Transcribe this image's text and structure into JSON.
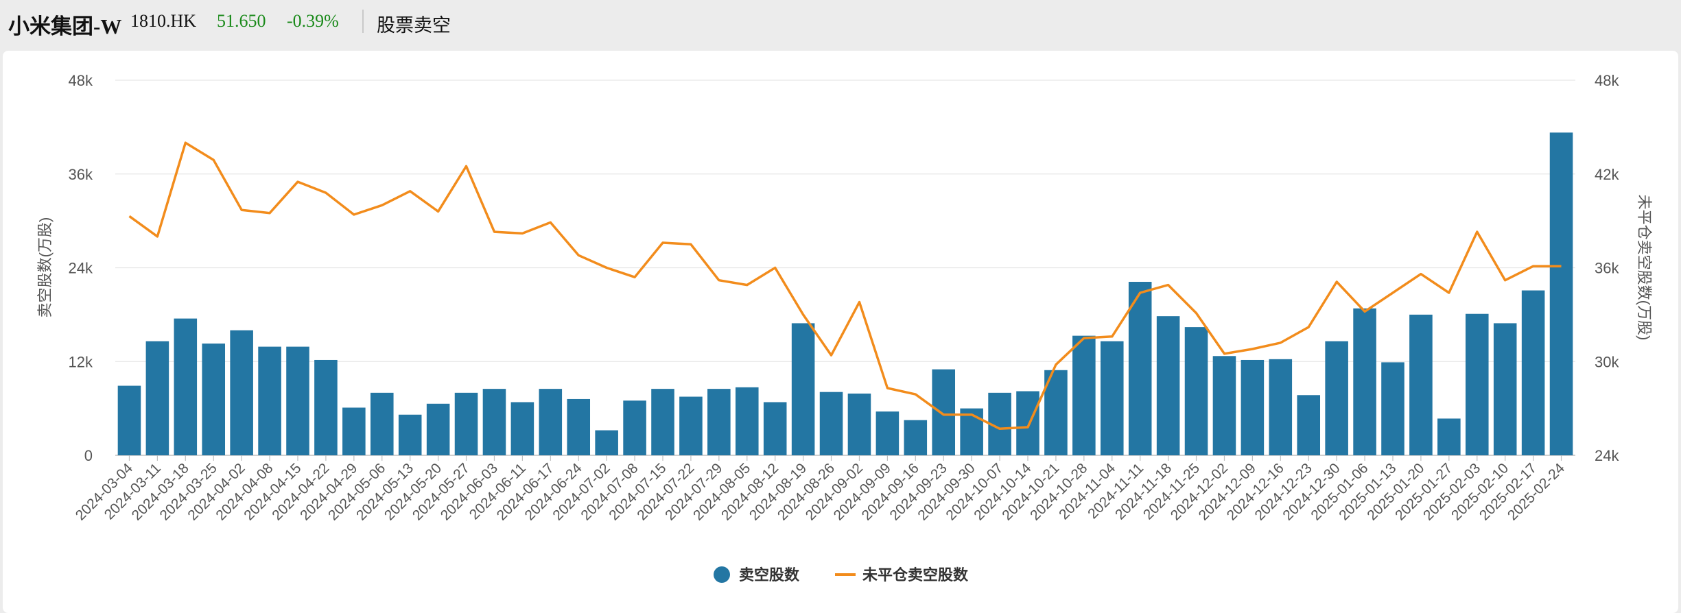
{
  "header": {
    "name": "小米集团-W",
    "code": "1810.HK",
    "price": "51.650",
    "change": "-0.39%",
    "section": "股票卖空",
    "price_color": "#1a8a1a",
    "change_color": "#1a8a1a"
  },
  "chart_data": {
    "type": "bar",
    "ylabel_left": "卖空股数(万股)",
    "ylabel_right": "未平仓卖空股数(万股)",
    "y_left": {
      "ticks": [
        0,
        12000,
        24000,
        36000,
        48000
      ],
      "labels": [
        "0",
        "12k",
        "24k",
        "36k",
        "48k"
      ],
      "range": [
        0,
        48000
      ]
    },
    "y_right": {
      "ticks": [
        24000,
        30000,
        36000,
        42000,
        48000
      ],
      "labels": [
        "24k",
        "30k",
        "36k",
        "42k",
        "48k"
      ],
      "range": [
        24000,
        48000
      ]
    },
    "grid": true,
    "legend_position": "bottom",
    "colors": {
      "bar": "#2376a3",
      "line": "#f28c1c"
    },
    "categories": [
      "2024-03-04",
      "2024-03-11",
      "2024-03-18",
      "2024-03-25",
      "2024-04-02",
      "2024-04-08",
      "2024-04-15",
      "2024-04-22",
      "2024-04-29",
      "2024-05-06",
      "2024-05-13",
      "2024-05-20",
      "2024-05-27",
      "2024-06-03",
      "2024-06-11",
      "2024-06-17",
      "2024-06-24",
      "2024-07-02",
      "2024-07-08",
      "2024-07-15",
      "2024-07-22",
      "2024-07-29",
      "2024-08-05",
      "2024-08-12",
      "2024-08-19",
      "2024-08-26",
      "2024-09-02",
      "2024-09-09",
      "2024-09-16",
      "2024-09-23",
      "2024-09-30",
      "2024-10-07",
      "2024-10-14",
      "2024-10-21",
      "2024-10-28",
      "2024-11-04",
      "2024-11-11",
      "2024-11-18",
      "2024-11-25",
      "2024-12-02",
      "2024-12-09",
      "2024-12-16",
      "2024-12-23",
      "2024-12-30",
      "2025-01-06",
      "2025-01-13",
      "2025-01-20",
      "2025-01-27",
      "2025-02-03",
      "2025-02-10",
      "2025-02-17",
      "2025-02-24"
    ],
    "series": [
      {
        "name": "卖空股数",
        "type": "bar",
        "axis": "left",
        "values": [
          8900,
          14600,
          17500,
          14300,
          16000,
          13900,
          13900,
          12200,
          6100,
          8000,
          5200,
          6600,
          8000,
          8500,
          6800,
          8500,
          7200,
          3200,
          7000,
          8500,
          7500,
          8500,
          8700,
          6800,
          16900,
          8100,
          7900,
          5600,
          4500,
          11000,
          6000,
          8000,
          8200,
          10900,
          15300,
          14600,
          22200,
          17800,
          16400,
          12700,
          12200,
          12300,
          7700,
          14600,
          18800,
          11900,
          18000,
          4700,
          18100,
          16900,
          21100,
          41300
        ]
      },
      {
        "name": "未平仓卖空股数",
        "type": "line",
        "axis": "right",
        "values": [
          39300,
          38000,
          44000,
          42900,
          39700,
          39500,
          41500,
          40800,
          39400,
          40000,
          40900,
          39600,
          42500,
          38300,
          38200,
          38900,
          36800,
          36000,
          35400,
          37600,
          37500,
          35200,
          34900,
          36000,
          33000,
          30400,
          33800,
          28300,
          27900,
          26600,
          26600,
          25700,
          25800,
          29800,
          31500,
          31600,
          34400,
          34900,
          33100,
          30500,
          30800,
          31200,
          32200,
          35100,
          33200,
          34400,
          35600,
          34400,
          38300,
          35200,
          36100,
          36100
        ]
      }
    ]
  }
}
